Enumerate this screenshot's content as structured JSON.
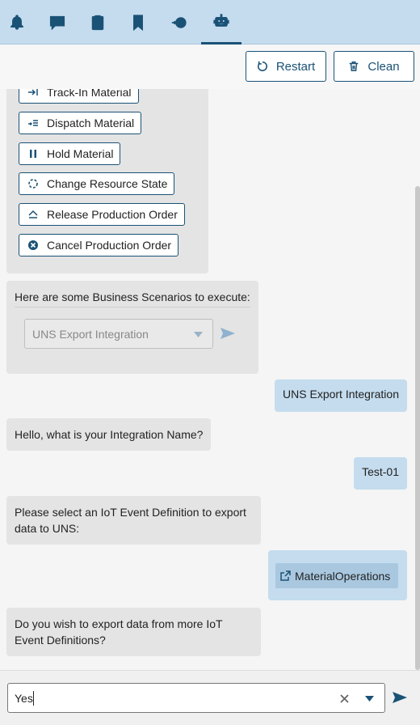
{
  "tabs": [
    {
      "icon": "bell-icon"
    },
    {
      "icon": "chat-icon"
    },
    {
      "icon": "clipboard-check-icon"
    },
    {
      "icon": "bookmark-icon"
    },
    {
      "icon": "sync-error-icon"
    },
    {
      "icon": "robot-icon",
      "active": true
    }
  ],
  "toolbar": {
    "restart_label": "Restart",
    "clean_label": "Clean"
  },
  "options": [
    {
      "label": "Track-In Material",
      "icon": "track-in-icon"
    },
    {
      "label": "Dispatch Material",
      "icon": "dispatch-icon"
    },
    {
      "label": "Hold Material",
      "icon": "pause-icon"
    },
    {
      "label": "Change Resource State",
      "icon": "refresh-dashed-icon"
    },
    {
      "label": "Release Production Order",
      "icon": "eject-icon"
    },
    {
      "label": "Cancel Production Order",
      "icon": "cancel-circle-icon"
    }
  ],
  "messages": {
    "scenarios_prompt": "Here are some Business Scenarios to execute:",
    "scenario_select_value": "UNS Export Integration",
    "user_reply_1": "UNS Export Integration",
    "bot_ask_name": "Hello, what is your Integration Name?",
    "user_reply_2": "Test-01",
    "bot_ask_iot": "Please select an IoT Event Definition to export data to UNS:",
    "user_reply_3": "MaterialOperations",
    "bot_ask_more": "Do you wish to export data from more IoT Event Definitions?"
  },
  "input": {
    "value": "Yes"
  },
  "colors": {
    "accent": "#1a5276",
    "tab_bar": "#c4dcee",
    "bot_bubble": "#e4e4e4",
    "user_bubble": "#c4dcee"
  }
}
